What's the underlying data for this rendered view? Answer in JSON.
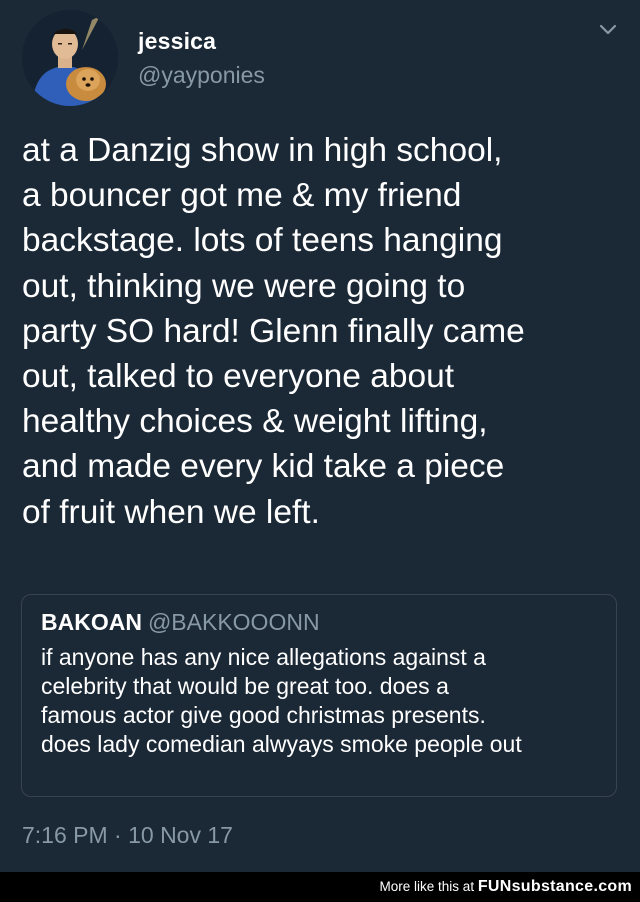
{
  "author": {
    "display_name": "jessica",
    "handle": "@yayponies",
    "avatar_icon": "avatar-image"
  },
  "tweet": {
    "text": "at a Danzig show in high school,\na bouncer got me & my friend\nbackstage. lots of teens hanging\nout, thinking we were going to\nparty SO hard! Glenn finally came\nout, talked to everyone about\nhealthy choices & weight lifting,\nand made every kid take a piece\nof fruit when we left.",
    "timestamp": "7:16 PM · 10 Nov 17"
  },
  "quoted_tweet": {
    "display_name": "BAKOAN",
    "handle": "@BAKKOOONN",
    "text": "if anyone has any nice allegations against a\ncelebrity that would be great too. does a\nfamous actor give good christmas presents.\ndoes lady comedian alwyays smoke people out"
  },
  "footer": {
    "prefix": "More like this at ",
    "brand": "FUNsubstance.com"
  },
  "colors": {
    "background": "#1b2836",
    "muted_text": "#8899a6",
    "border": "#38444d",
    "footer_bg": "#000000"
  }
}
